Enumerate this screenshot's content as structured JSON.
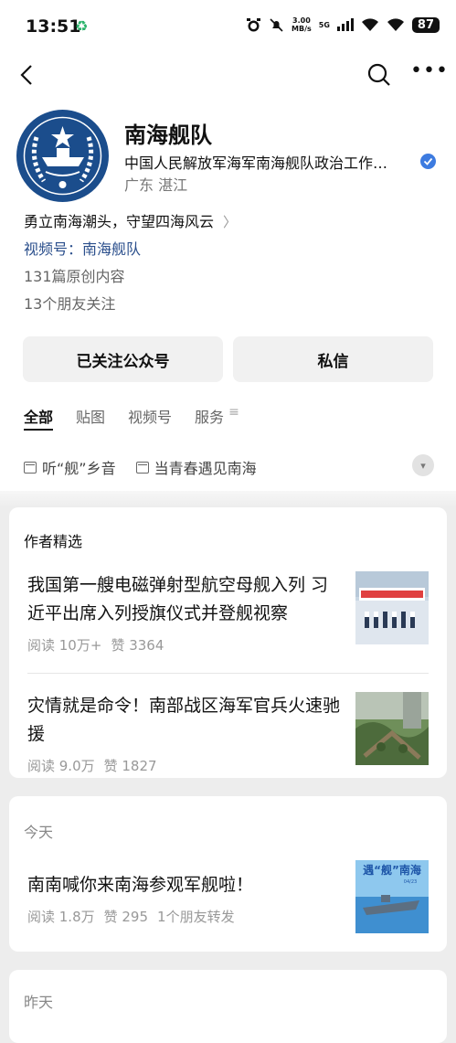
{
  "status_bar": {
    "time": "13:51",
    "speed_value": "3.00",
    "speed_unit": "MB/s",
    "network": "5G",
    "battery": "87",
    "icons": [
      "alarm-icon",
      "mute-icon",
      "signal-icon",
      "wifi-icon"
    ]
  },
  "nav": {
    "icons": [
      "back-icon",
      "search-icon",
      "more-icon"
    ]
  },
  "profile": {
    "name": "南海舰队",
    "organization": "中国人民解放军海军南海舰队政治工作…",
    "location": "广东 湛江",
    "slogan": "勇立南海潮头，守望四海风云",
    "channel": "视频号：南海舰队",
    "original_count": "131篇原创内容",
    "friends_following": "13个朋友关注"
  },
  "actions": {
    "follow": "已关注公众号",
    "message": "私信"
  },
  "tabs": [
    "全部",
    "贴图",
    "视频号",
    "服务"
  ],
  "collections": [
    "听“舰”乡音",
    "当青春遇见南海"
  ],
  "featured": {
    "title": "作者精选",
    "articles": [
      {
        "title": "我国第一艘电磁弹射型航空母舰入列 习近平出席入列授旗仪式并登舰视察",
        "reads": "阅读 10万+",
        "likes": "赞 3364"
      },
      {
        "title": "灾情就是命令！南部战区海军官兵火速驰援",
        "reads": "阅读 9.0万",
        "likes": "赞 1827"
      }
    ]
  },
  "today": {
    "label": "今天",
    "article": {
      "title": "南南喊你来南海参观军舰啦！",
      "reads": "阅读 1.8万",
      "likes": "赞 295",
      "shares": "1个朋友转发",
      "thumb_text": "遇“舰”南海",
      "thumb_date": "04/23"
    }
  },
  "yesterday": {
    "label": "昨天"
  },
  "colors": {
    "accent_blue": "#2b4f8c",
    "verify_blue": "#3d7be0"
  }
}
